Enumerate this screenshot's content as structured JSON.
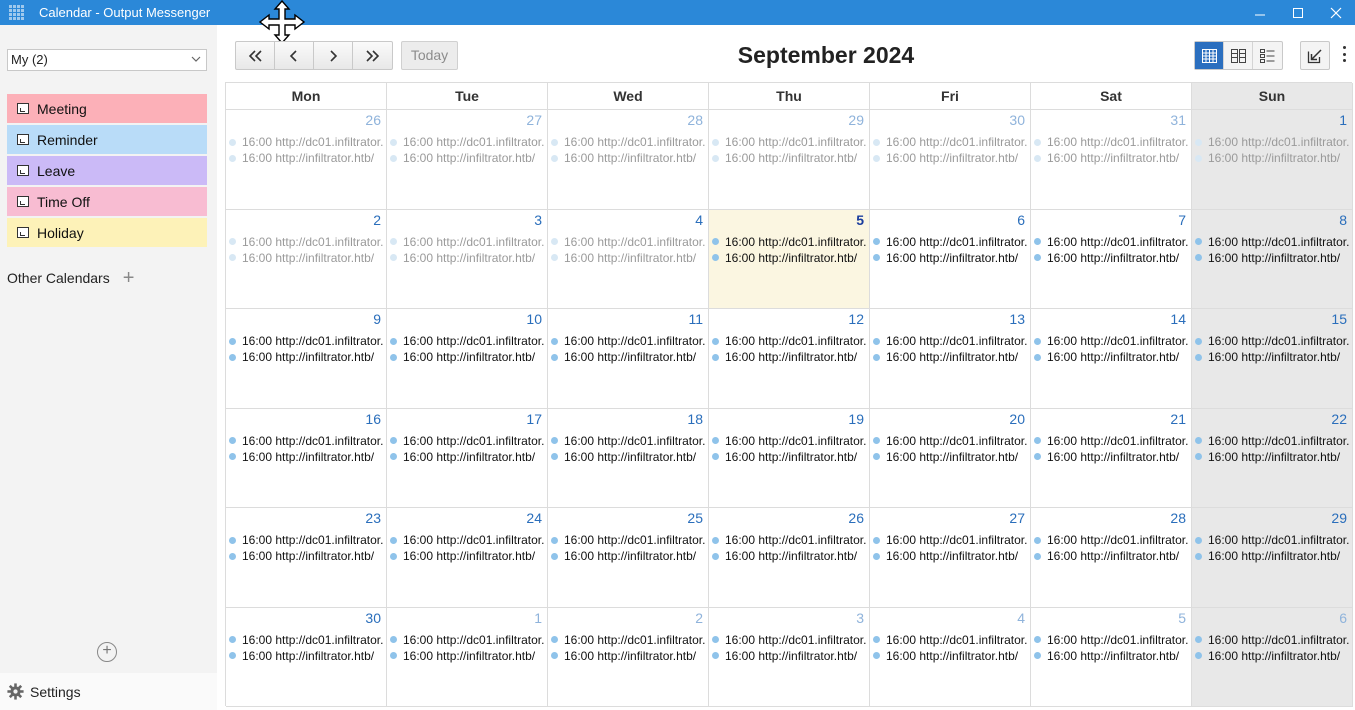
{
  "window": {
    "title": "Calendar - Output Messenger",
    "controls": [
      "minimize",
      "maximize",
      "close"
    ]
  },
  "sidebar": {
    "calendar_select": "My (2)",
    "categories": [
      {
        "label": "Meeting",
        "color": "#fcb0b8"
      },
      {
        "label": "Reminder",
        "color": "#b9dcf8"
      },
      {
        "label": "Leave",
        "color": "#cbbaf7"
      },
      {
        "label": "Time Off",
        "color": "#f8bcd2"
      },
      {
        "label": "Holiday",
        "color": "#fdf2b8"
      }
    ],
    "other_calendars_label": "Other Calendars",
    "settings_label": "Settings"
  },
  "toolbar": {
    "today_label": "Today",
    "month_title": "September 2024"
  },
  "weekdays": [
    "Mon",
    "Tue",
    "Wed",
    "Thu",
    "Fri",
    "Sat",
    "Sun"
  ],
  "event_texts": [
    "16:00 http://dc01.infiltrator.",
    "16:00 http://infiltrator.htb/"
  ],
  "weeks": [
    [
      26,
      27,
      28,
      29,
      30,
      31,
      1
    ],
    [
      2,
      3,
      4,
      5,
      6,
      7,
      8
    ],
    [
      9,
      10,
      11,
      12,
      13,
      14,
      15
    ],
    [
      16,
      17,
      18,
      19,
      20,
      21,
      22
    ],
    [
      23,
      24,
      25,
      26,
      27,
      28,
      29
    ],
    [
      30,
      1,
      2,
      3,
      4,
      5,
      6
    ]
  ],
  "colors": {
    "titlebar": "#2b88d8",
    "accent": "#2b6fbf",
    "today_bg": "#fbf6e1",
    "weekend_bg": "#e8e8e8"
  }
}
